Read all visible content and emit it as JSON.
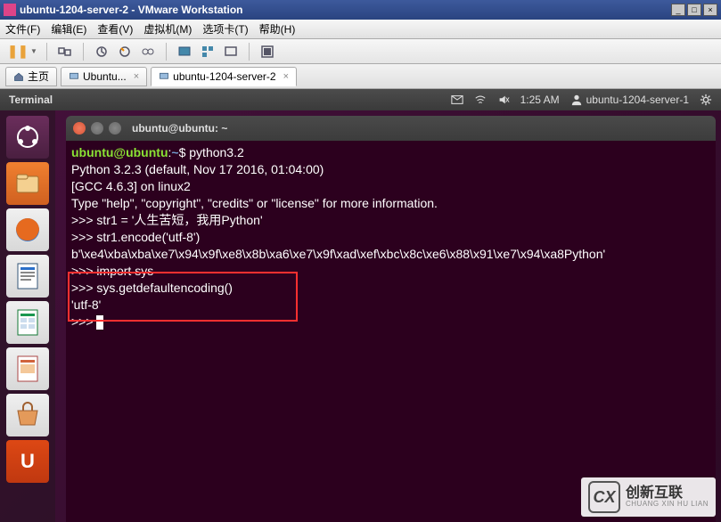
{
  "vmware": {
    "window_title": "ubuntu-1204-server-2 - VMware Workstation",
    "menu": {
      "file": "文件(F)",
      "edit": "编辑(E)",
      "view": "查看(V)",
      "vm": "虚拟机(M)",
      "tabs": "选项卡(T)",
      "help": "帮助(H)"
    },
    "tabs": {
      "home": "主页",
      "vm1": "Ubuntu...",
      "vm2": "ubuntu-1204-server-2"
    },
    "winbtns": {
      "min": "_",
      "max": "□",
      "close": "×"
    }
  },
  "ubuntu": {
    "panel": {
      "app_title": "Terminal",
      "time": "1:25 AM",
      "user": "ubuntu-1204-server-1"
    },
    "launcher": {
      "ubuntu_letter": "U"
    },
    "terminal": {
      "title": "ubuntu@ubuntu: ~",
      "prompt_user": "ubuntu@ubuntu",
      "prompt_sep": ":",
      "prompt_path": "~",
      "prompt_end": "$ ",
      "lines": {
        "cmd1": "python3.2",
        "out1": "Python 3.2.3 (default, Nov 17 2016, 01:04:00)",
        "out2": "[GCC 4.6.3] on linux2",
        "out3": "Type \"help\", \"copyright\", \"credits\" or \"license\" for more information.",
        "py_prompt": ">>> ",
        "pycmd1": "str1 = '人生苦短，我用Python'",
        "pycmd2": "str1.encode('utf-8')",
        "pyout1": "b'\\xe4\\xba\\xba\\xe7\\x94\\x9f\\xe8\\x8b\\xa6\\xe7\\x9f\\xad\\xef\\xbc\\x8c\\xe6\\x88\\x91\\xe7\\x94\\xa8Python'",
        "pycmd3": "import sys",
        "pycmd4": "sys.getdefaultencoding()",
        "pyout2": "'utf-8'"
      }
    }
  },
  "watermark": {
    "logo": "CX",
    "cn": "创新互联",
    "py": "CHUANG XIN HU LIAN"
  }
}
